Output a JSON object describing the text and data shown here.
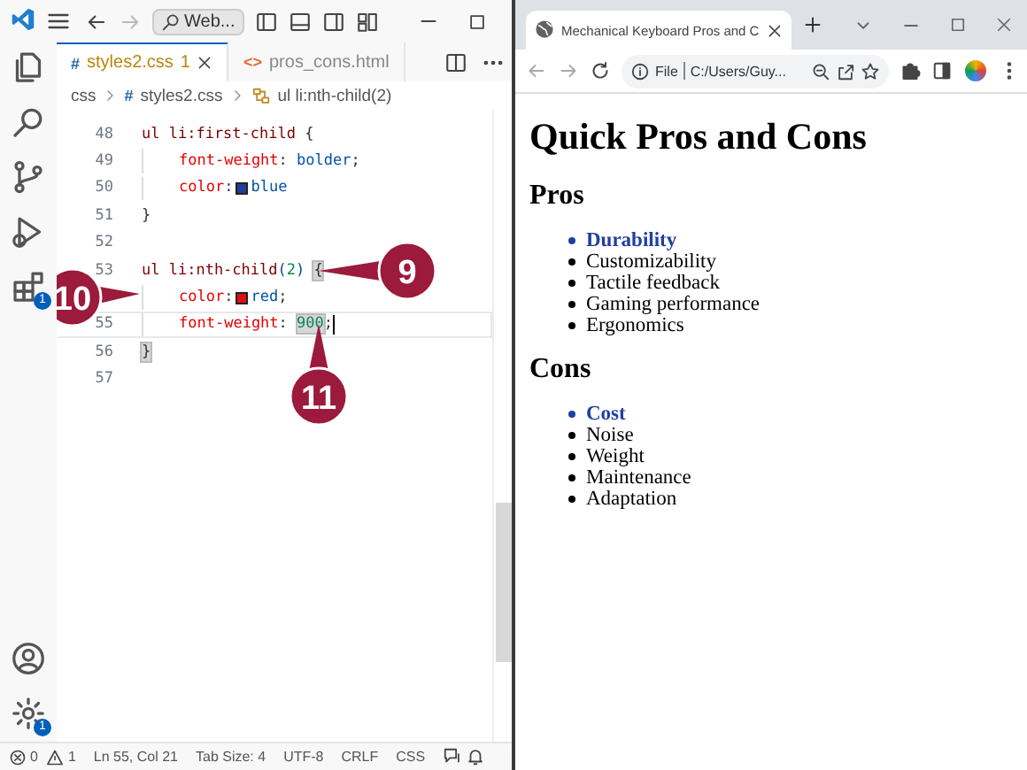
{
  "editor_window": {
    "title_bar": {
      "search": "Web..."
    },
    "activity_bar": {
      "top": [
        {
          "kind": "files"
        },
        {
          "kind": "search"
        },
        {
          "kind": "source-control"
        },
        {
          "kind": "run"
        },
        {
          "kind": "extensions",
          "badge": "1"
        }
      ],
      "bottom": [
        {
          "kind": "account"
        },
        {
          "kind": "settings",
          "badge": "1"
        }
      ]
    },
    "tabs": [
      {
        "icon": "#",
        "label": "styles2.css",
        "badge": "1",
        "selected": true
      },
      {
        "icon": "<>",
        "label": "pros_cons.html",
        "selected": false
      }
    ],
    "breadcrumbs": [
      {
        "kind": "folder",
        "text": "css"
      },
      {
        "kind": "file",
        "icon": "#",
        "text": "styles2.css"
      },
      {
        "kind": "symbol",
        "text": "ul li:nth-child(2)"
      }
    ],
    "code_lines": [
      {
        "number": "48",
        "tokens": [
          {
            "kind": "selector",
            "text": "ul li:first-child "
          },
          {
            "kind": "brace",
            "text": "{"
          }
        ]
      },
      {
        "number": "49",
        "indent": true,
        "tokens": [
          {
            "kind": "property",
            "text": "font-weight"
          },
          {
            "kind": "punct",
            "text": ": "
          },
          {
            "kind": "value",
            "text": "bolder"
          },
          {
            "kind": "punct",
            "text": ";"
          }
        ]
      },
      {
        "number": "50",
        "indent": true,
        "tokens": [
          {
            "kind": "property",
            "text": "color"
          },
          {
            "kind": "punct",
            "text": ":"
          },
          {
            "kind": "swatch",
            "color": "#1f3f99"
          },
          {
            "kind": "value",
            "text": "blue"
          }
        ]
      },
      {
        "number": "51",
        "tokens": [
          {
            "kind": "brace",
            "text": "}"
          }
        ]
      },
      {
        "number": "52"
      },
      {
        "number": "53",
        "tokens": [
          {
            "kind": "selector",
            "text": "ul li:nth-child"
          },
          {
            "kind": "value",
            "text": "("
          },
          {
            "kind": "number",
            "text": "2"
          },
          {
            "kind": "value",
            "text": ") "
          },
          {
            "kind": "brace",
            "text": "{",
            "boxed": true
          }
        ],
        "callout": {
          "kind": "right",
          "number": "9"
        }
      },
      {
        "indent": true,
        "tokens": [
          {
            "kind": "property",
            "text": "color"
          },
          {
            "kind": "punct",
            "text": ":"
          },
          {
            "kind": "swatch",
            "color": "#e01010"
          },
          {
            "kind": "value",
            "text": "red"
          },
          {
            "kind": "punct",
            "text": ";"
          }
        ],
        "callout": {
          "kind": "left",
          "number": "10"
        }
      },
      {
        "number": "55",
        "indent": true,
        "current": true,
        "tokens": [
          {
            "kind": "property",
            "text": "font-weight"
          },
          {
            "kind": "punct",
            "text": ": "
          },
          {
            "kind": "number",
            "text": "900",
            "boxed": true
          },
          {
            "kind": "punct",
            "text": ";"
          }
        ],
        "callout": {
          "kind": "below",
          "number": "11"
        }
      },
      {
        "number": "56",
        "tokens": [
          {
            "kind": "brace",
            "text": "}",
            "boxed": true
          }
        ]
      },
      {
        "number": "57"
      }
    ],
    "status_bar": {
      "errors": "0",
      "warnings": "1",
      "items": [
        "Ln 55, Col 21",
        "Tab Size: 4",
        "UTF-8",
        "CRLF",
        "CSS"
      ]
    }
  },
  "browser_window": {
    "tab_title": "Mechanical Keyboard Pros and C",
    "scheme": "File",
    "address": "C:/Users/Guy...",
    "page": {
      "heading": "Quick Pros and Cons",
      "sections": [
        {
          "heading": "Pros",
          "items": [
            {
              "text": "Durability",
              "emphasized": true
            },
            {
              "text": "Customizability",
              "emphasized": false
            },
            {
              "text": "Tactile feedback",
              "emphasized": false
            },
            {
              "text": "Gaming performance",
              "emphasized": false
            },
            {
              "text": "Ergonomics",
              "emphasized": false
            }
          ]
        },
        {
          "heading": "Cons",
          "items": [
            {
              "text": "Cost",
              "emphasized": true
            },
            {
              "text": "Noise",
              "emphasized": false
            },
            {
              "text": "Weight",
              "emphasized": false
            },
            {
              "text": "Maintenance",
              "emphasized": false
            },
            {
              "text": "Adaptation",
              "emphasized": false
            }
          ]
        }
      ]
    }
  }
}
